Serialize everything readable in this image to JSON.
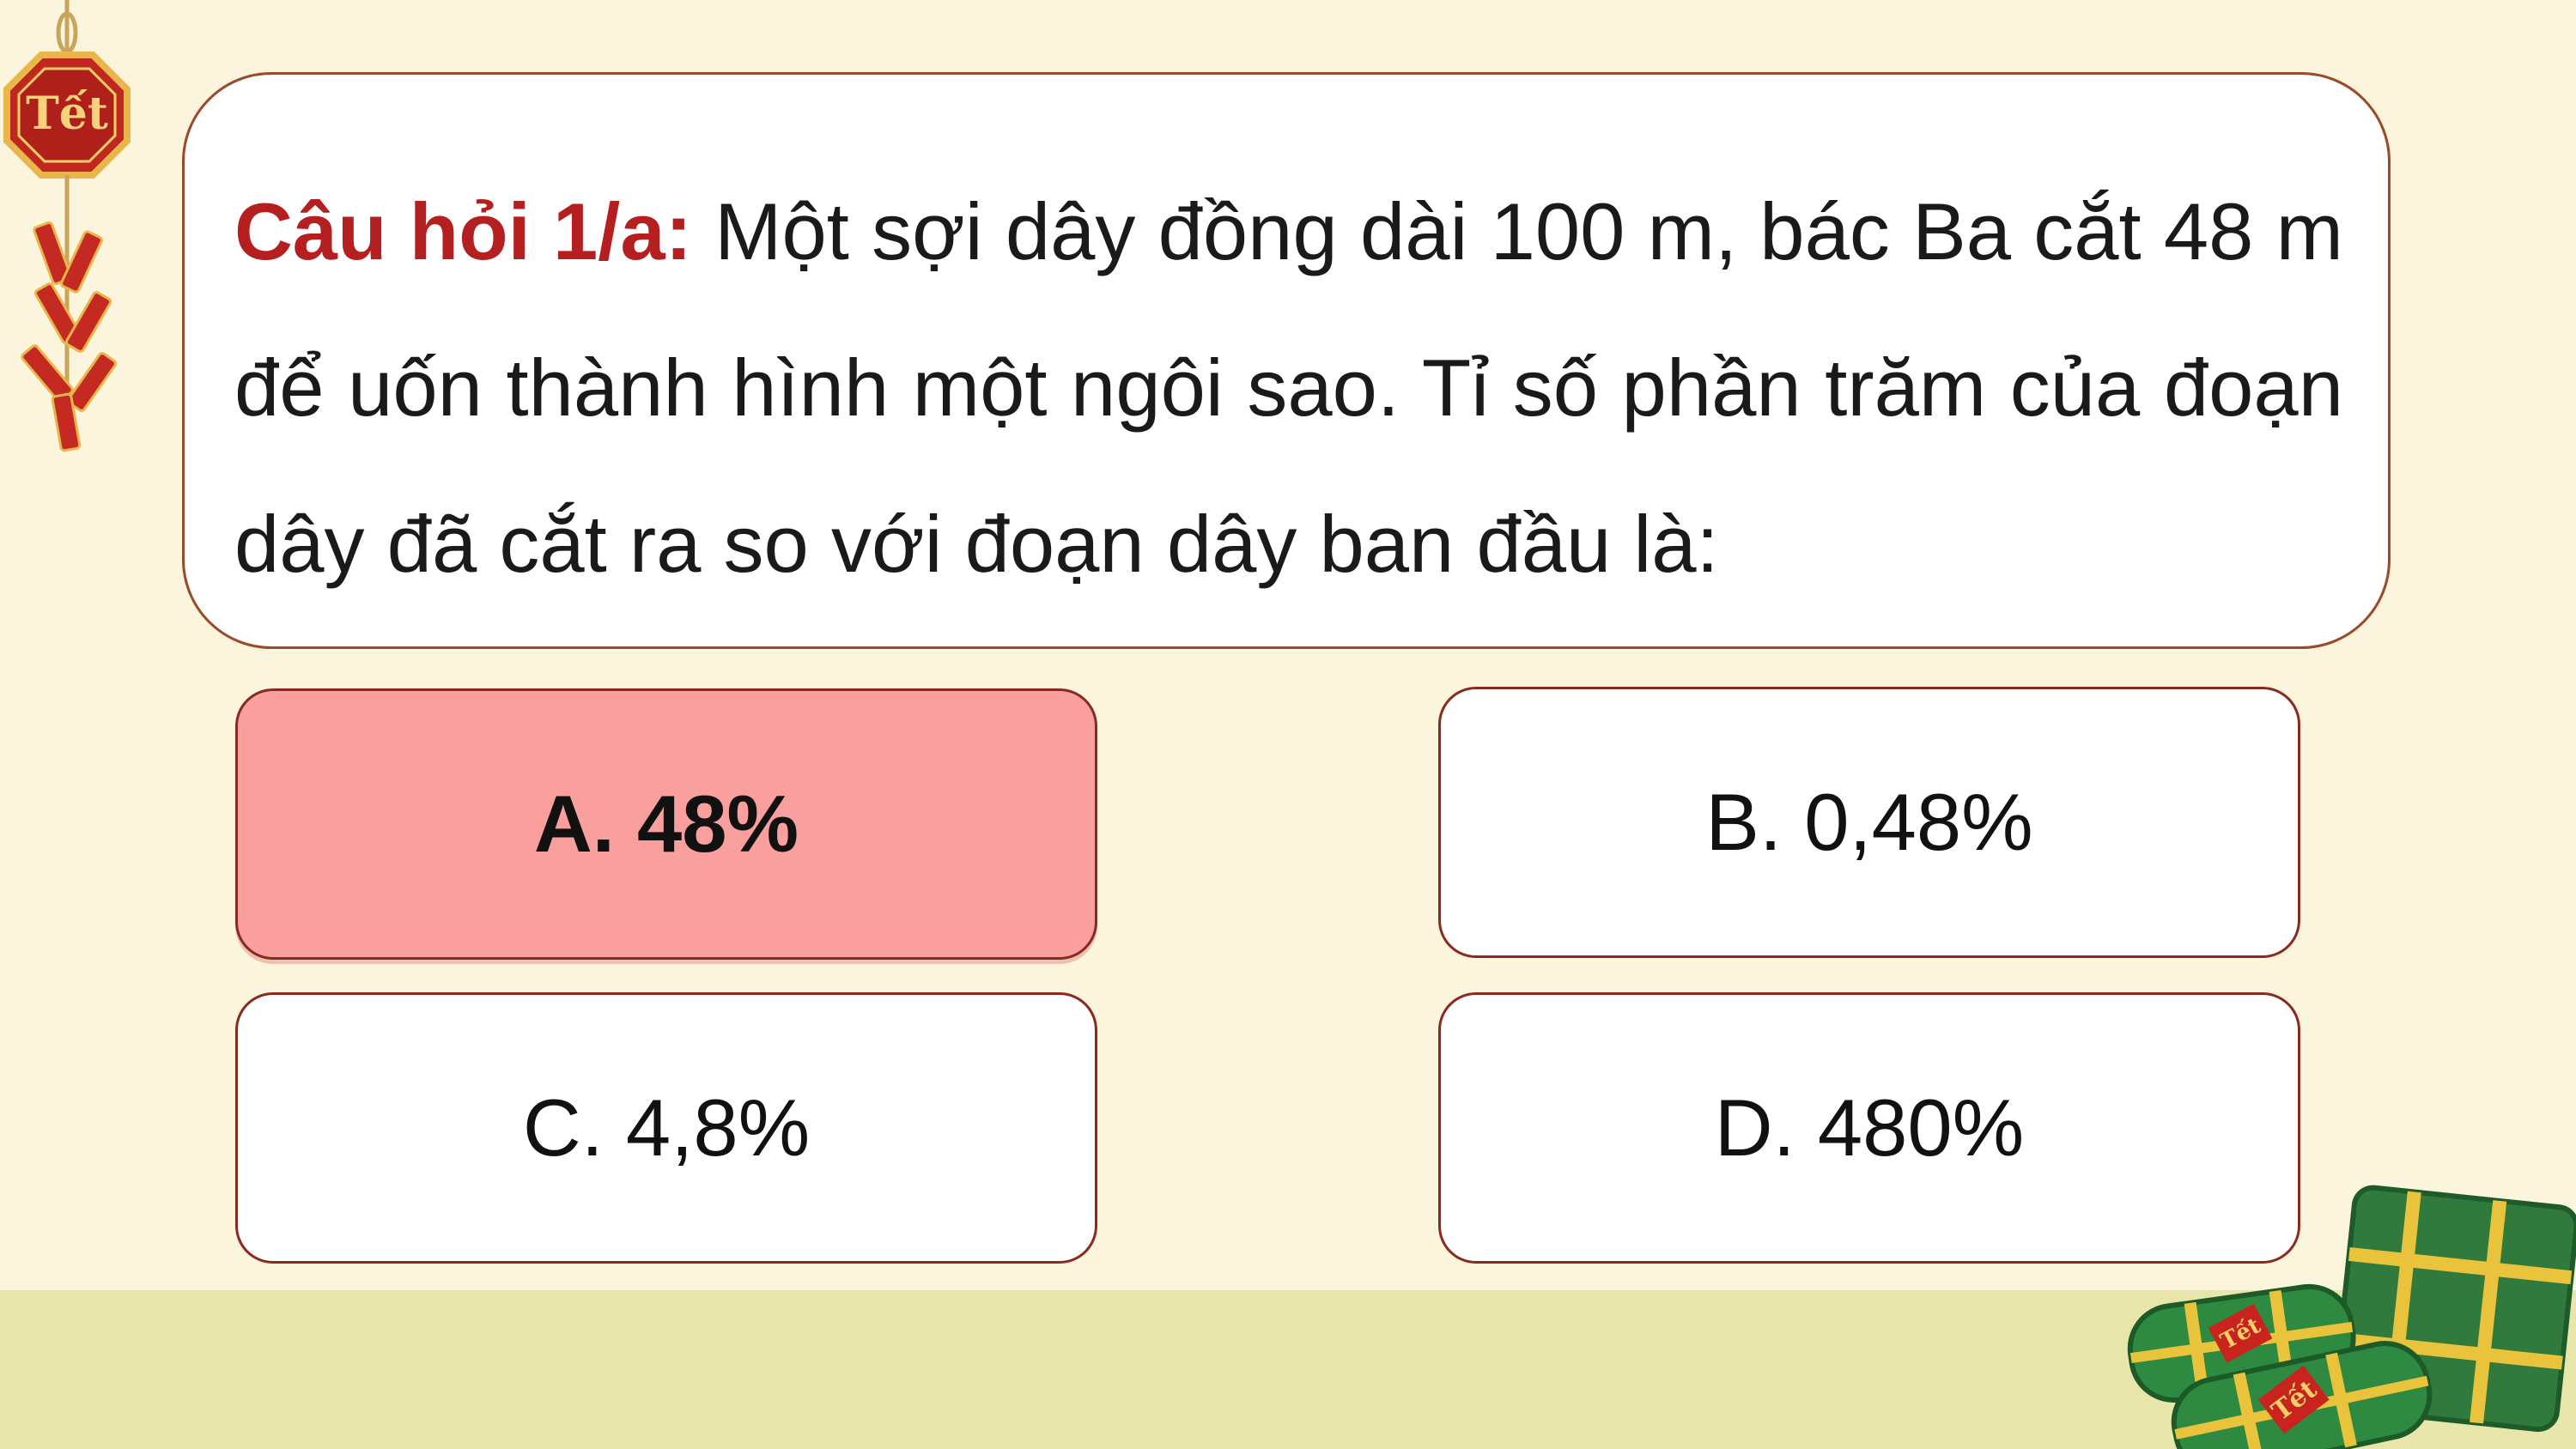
{
  "question": {
    "label": "Câu hỏi 1/a:",
    "text": " Một sợi dây đồng dài 100 m, bác Ba cắt 48 m để uốn thành hình một ngôi sao. Tỉ số phần trăm của đoạn dây đã cắt ra so với đoạn dây ban đầu là:"
  },
  "answers": [
    {
      "label": "A. 48%",
      "selected": true
    },
    {
      "label": "B. 0,48%",
      "selected": false
    },
    {
      "label": "C. 4,8%",
      "selected": false
    },
    {
      "label": "D. 480%",
      "selected": false
    }
  ],
  "decorations": {
    "ornament_text": "Tết",
    "cake_text_1": "Tết",
    "cake_text_2": "Tết"
  },
  "colors": {
    "background": "#faf5dc",
    "accent_red": "#b51f1f",
    "selected_answer": "#f9a09e",
    "border": "#8a2a1e"
  }
}
